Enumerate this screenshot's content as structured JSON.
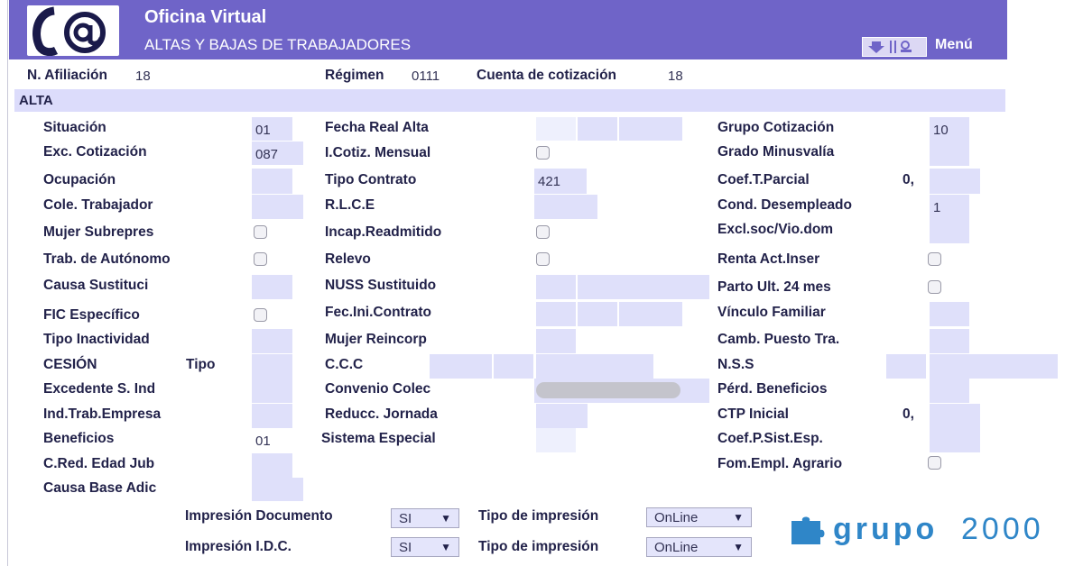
{
  "header": {
    "title": "Oficina Virtual",
    "subtitle": "ALTAS Y BAJAS DE TRABAJADORES",
    "menu_label": "Menú"
  },
  "topbar": {
    "afiliacion_label": "N. Afiliación",
    "afiliacion_value": "18",
    "regimen_label": "Régimen",
    "regimen_value": "0111",
    "cuenta_label": "Cuenta de cotización",
    "cuenta_value": "18"
  },
  "section": {
    "title": "ALTA"
  },
  "col1": {
    "situacion": "Situación",
    "situacion_value": "01",
    "exc_cotizacion": "Exc. Cotización",
    "exc_cotizacion_value": "087",
    "ocupacion": "Ocupación",
    "cole_trabajador": "Cole. Trabajador",
    "mujer_subrepres": "Mujer Subrepres",
    "trab_autonomo": "Trab. de Autónomo",
    "causa_sustituci": "Causa Sustituci",
    "fic_especifico": "FIC Específico",
    "tipo_inactividad": "Tipo Inactividad",
    "cesion": "CESIÓN",
    "cesion_tipo": "Tipo",
    "excedente": "Excedente S. Ind",
    "ind_trab_empresa": "Ind.Trab.Empresa",
    "beneficios": "Beneficios",
    "beneficios_value": "01",
    "c_red_edad": "C.Red. Edad Jub",
    "causa_base": "Causa Base Adic"
  },
  "col2": {
    "fecha_real_alta": "Fecha Real Alta",
    "icotiz_mensual": "I.Cotiz. Mensual",
    "tipo_contrato": "Tipo Contrato",
    "tipo_contrato_value": "421",
    "rlce": "R.L.C.E",
    "incap_readmitido": "Incap.Readmitido",
    "relevo": "Relevo",
    "nuss_sustituido": "NUSS Sustituido",
    "fec_ini_contrato": "Fec.Ini.Contrato",
    "mujer_reincorp": "Mujer Reincorp",
    "ccc": "C.C.C",
    "convenio_colec": "Convenio Colec",
    "reducc_jornada": "Reducc. Jornada",
    "sistema_especial": "Sistema Especial"
  },
  "col3": {
    "grupo_cotizacion": "Grupo Cotización",
    "grupo_cotizacion_value": "10",
    "grado_minusvalia": "Grado Minusvalía",
    "coef_tparcial": "Coef.T.Parcial",
    "coef_tparcial_prefix": "0,",
    "cond_desempleado": "Cond. Desempleado",
    "cond_desempleado_value": "1",
    "excl_soc": "Excl.soc/Vio.dom",
    "renta_act": "Renta Act.Inser",
    "parto_ult": "Parto Ult. 24 mes",
    "vinculo_familiar": "Vínculo Familiar",
    "camb_puesto": "Camb. Puesto Tra.",
    "nss": "N.S.S",
    "perd_beneficios": "Pérd. Beneficios",
    "ctp_inicial": "CTP Inicial",
    "ctp_inicial_prefix": "0,",
    "coef_psist": "Coef.P.Sist.Esp.",
    "fom_empl": "Fom.Empl. Agrario"
  },
  "bottom": {
    "impresion_documento": "Impresión Documento",
    "impresion_idc": "Impresión I.D.C.",
    "tipo_impresion": "Tipo de impresión",
    "si_option": "SI",
    "online_option": "OnLine"
  },
  "brand": {
    "bold": "grupo",
    "light": "2000"
  },
  "colors": {
    "header": "#6f64c8",
    "field": "#dfe0fa",
    "brand": "#2f86c8"
  }
}
